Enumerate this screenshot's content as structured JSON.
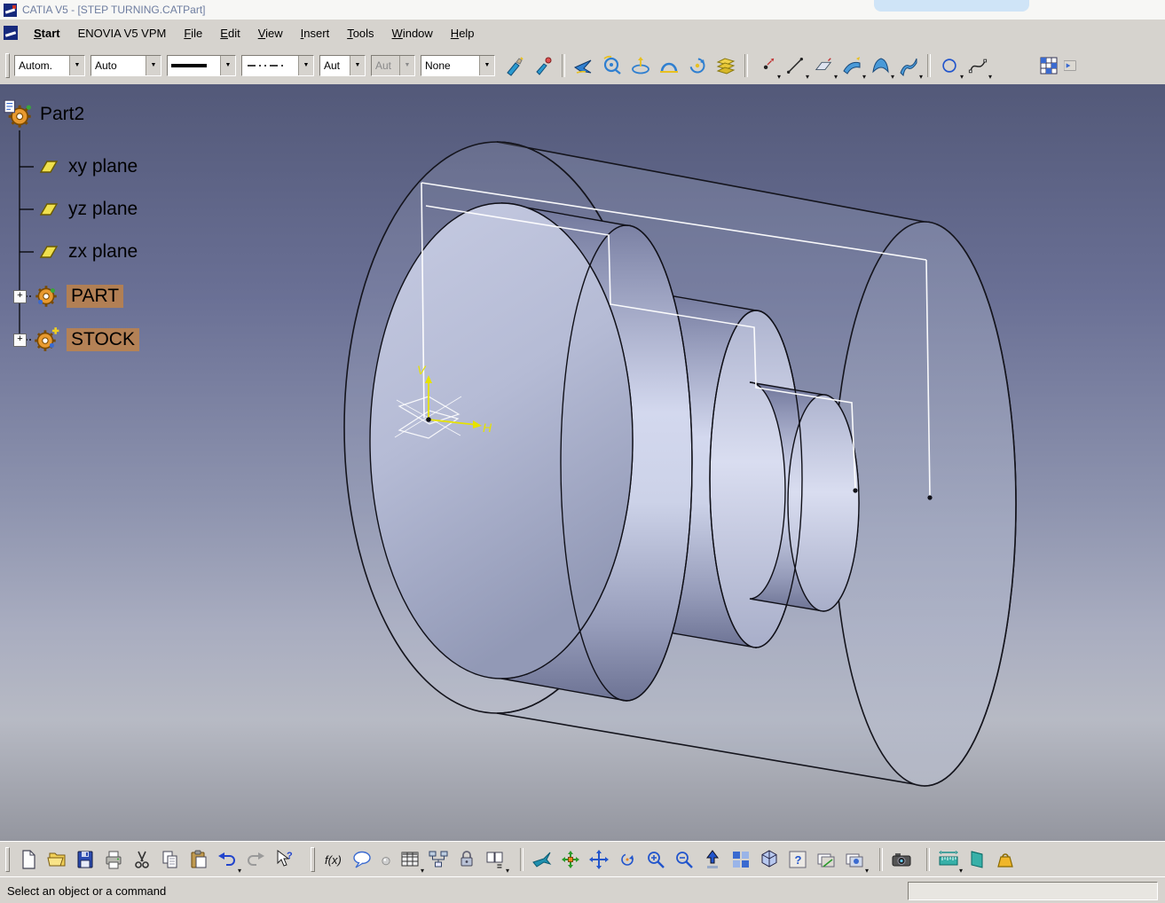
{
  "window": {
    "title": "CATIA V5 - [STEP TURNING.CATPart]"
  },
  "menu": {
    "items": [
      {
        "label": "Start",
        "underline": 0,
        "bold": true
      },
      {
        "label": "ENOVIA V5 VPM",
        "underline": -1
      },
      {
        "label": "File",
        "underline": 0
      },
      {
        "label": "Edit",
        "underline": 0
      },
      {
        "label": "View",
        "underline": 0
      },
      {
        "label": "Insert",
        "underline": 0
      },
      {
        "label": "Tools",
        "underline": 0
      },
      {
        "label": "Window",
        "underline": 0
      },
      {
        "label": "Help",
        "underline": 0
      }
    ]
  },
  "toolbar_top": {
    "graphic_properties_combo": "Autom.",
    "layer_combo": "Auto",
    "point_combo1": "Aut",
    "point_combo2": "Aut",
    "render_combo": "None"
  },
  "tree": {
    "root_label": "Part2",
    "expander_glyph": "+",
    "items": [
      {
        "label": "xy plane"
      },
      {
        "label": "yz plane"
      },
      {
        "label": "zx plane"
      },
      {
        "label": "PART"
      },
      {
        "label": "STOCK"
      }
    ]
  },
  "viewport": {
    "axis_v": "V",
    "axis_h": "H"
  },
  "icons": {
    "dropdown_arrow": "▼",
    "small_arrow": "▾",
    "fx": "f(x)",
    "question": "?",
    "equals": "="
  },
  "status_bar": {
    "message": "Select an object or a command"
  }
}
